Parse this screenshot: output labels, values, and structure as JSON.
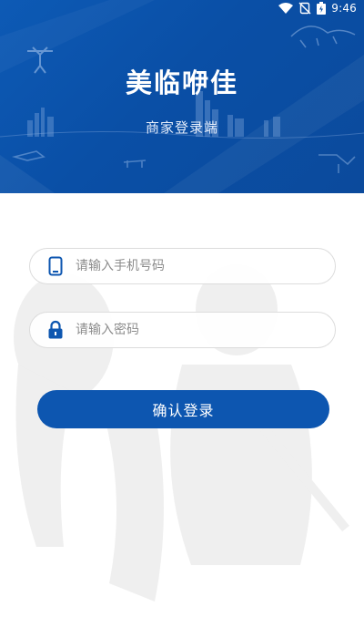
{
  "status_bar": {
    "time": "9:46",
    "icons": [
      "wifi-icon",
      "sim-off-icon",
      "battery-charging-icon"
    ]
  },
  "header": {
    "title": "美临咿佳",
    "subtitle": "商家登录端",
    "background_color": "#0b52a8"
  },
  "form": {
    "phone": {
      "icon": "phone-icon",
      "value": "",
      "placeholder": "请输入手机号码"
    },
    "password": {
      "icon": "lock-icon",
      "value": "",
      "placeholder": "请输入密码"
    },
    "submit_label": "确认登录",
    "accent_color": "#0d56b0"
  }
}
